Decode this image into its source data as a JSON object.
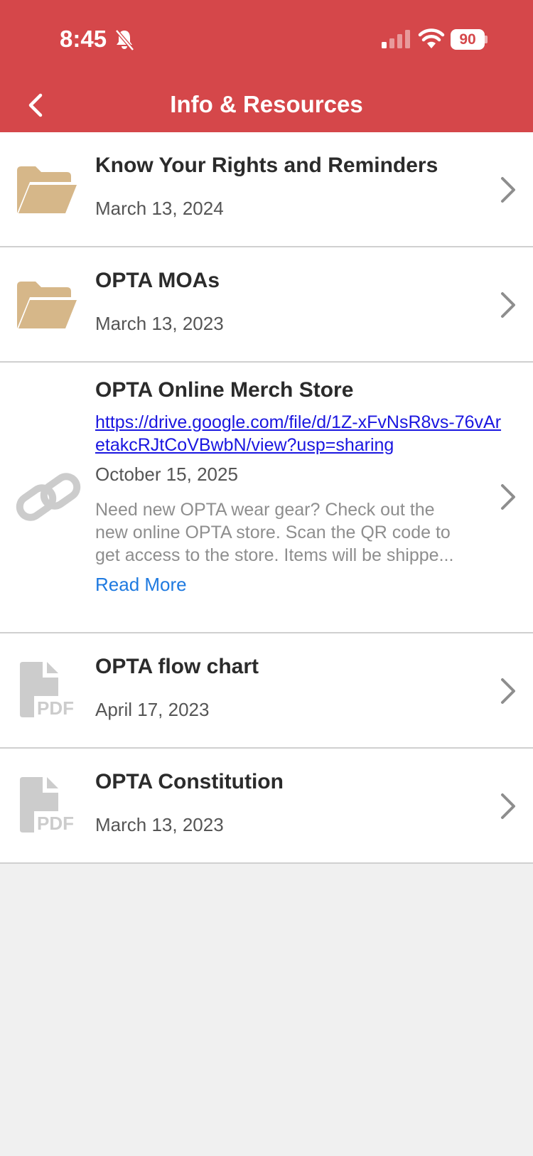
{
  "status_bar": {
    "time": "8:45",
    "battery": "90"
  },
  "header": {
    "title": "Info & Resources"
  },
  "items": [
    {
      "title": "Know Your Rights and Reminders",
      "date": "March 13, 2024",
      "icon": "folder-icon"
    },
    {
      "title": "OPTA MOAs",
      "date": "March 13, 2023",
      "icon": "folder-icon"
    },
    {
      "title": "OPTA Online Merch Store",
      "link": "https://drive.google.com/file/d/1Z-xFvNsR8vs-76vAretakcRJtCoVBwbN/view?usp=sharing",
      "date": "October 15, 2025",
      "description_lines": [
        "Need new OPTA wear gear? Check out the",
        "new online OPTA store.  Scan the QR code to",
        "get access to the store.  Items will be shippe..."
      ],
      "read_more": "Read More",
      "icon": "link-icon"
    },
    {
      "title": "OPTA flow chart",
      "date": "April 17, 2023",
      "icon": "pdf-icon"
    },
    {
      "title": "OPTA Constitution",
      "date": "March 13, 2023",
      "icon": "pdf-icon"
    }
  ],
  "colors": {
    "header": "#d5474a",
    "folder": "#d6b789",
    "link_text": "#1a16e0",
    "read_more": "#1f7ae0",
    "icon_gray": "#cccccc"
  }
}
